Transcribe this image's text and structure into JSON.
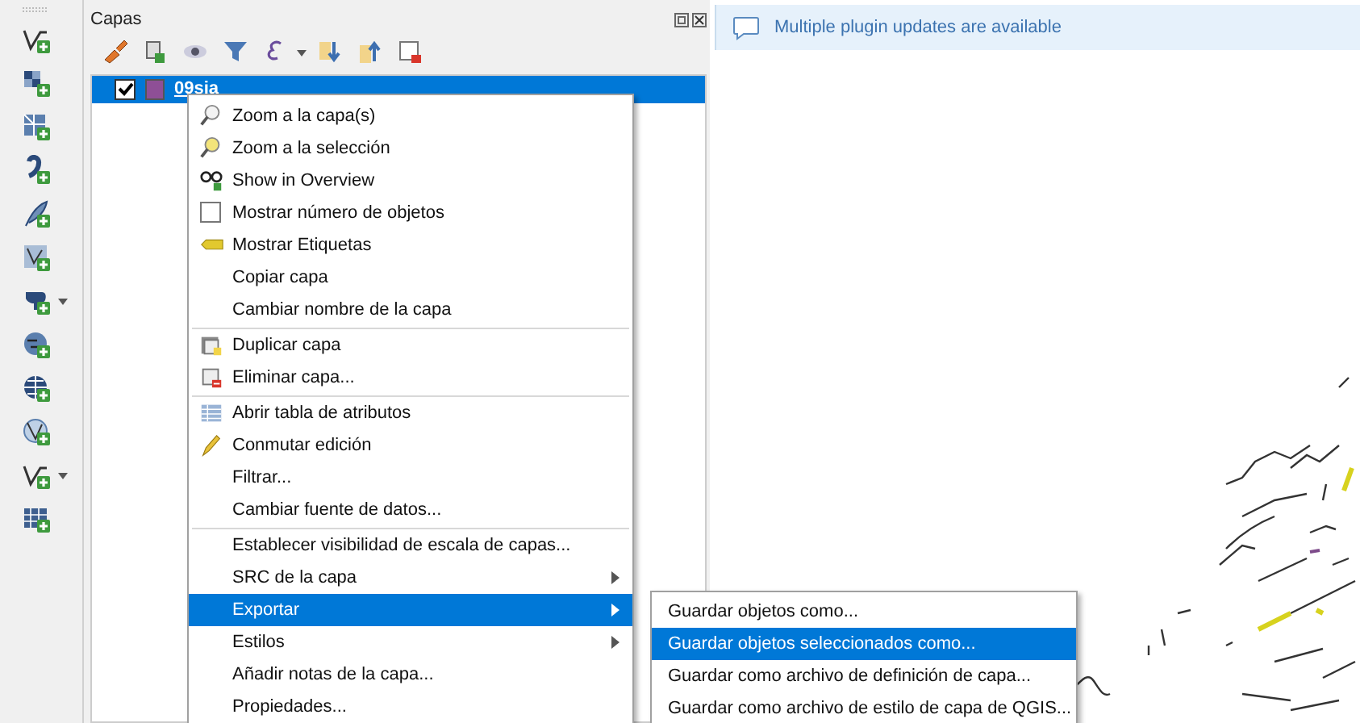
{
  "layers_panel": {
    "title": "Capas",
    "layers": [
      {
        "name": "09sia",
        "checked": true,
        "selected": true,
        "color": "#8e4f96"
      }
    ]
  },
  "message_bar": {
    "text": "Multiple plugin updates are available"
  },
  "context_menu": {
    "items": [
      {
        "kind": "action",
        "label": "Zoom a la capa(s)",
        "selected": false
      },
      {
        "kind": "action",
        "label": "Zoom a la selección",
        "selected": false
      },
      {
        "kind": "action",
        "label": "Show in Overview",
        "selected": false
      },
      {
        "kind": "checkbox",
        "label": "Mostrar número de objetos",
        "checked": false,
        "selected": false
      },
      {
        "kind": "action",
        "label": "Mostrar Etiquetas",
        "selected": false
      },
      {
        "kind": "action",
        "label": "Copiar capa",
        "selected": false
      },
      {
        "kind": "action",
        "label": "Cambiar nombre de la capa",
        "selected": false
      },
      {
        "kind": "separator"
      },
      {
        "kind": "action",
        "label": "Duplicar capa",
        "selected": false
      },
      {
        "kind": "action",
        "label": "Eliminar capa...",
        "selected": false
      },
      {
        "kind": "separator"
      },
      {
        "kind": "action",
        "label": "Abrir tabla de atributos",
        "selected": false
      },
      {
        "kind": "action",
        "label": "Conmutar edición",
        "selected": false
      },
      {
        "kind": "action",
        "label": "Filtrar...",
        "selected": false
      },
      {
        "kind": "action",
        "label": "Cambiar fuente de datos...",
        "selected": false
      },
      {
        "kind": "separator"
      },
      {
        "kind": "action",
        "label": "Establecer visibilidad de escala de capas...",
        "selected": false
      },
      {
        "kind": "submenu",
        "label": "SRC de la capa",
        "selected": false
      },
      {
        "kind": "submenu",
        "label": "Exportar",
        "selected": true
      },
      {
        "kind": "submenu",
        "label": "Estilos",
        "selected": false
      },
      {
        "kind": "action",
        "label": "Añadir notas de la capa...",
        "selected": false
      },
      {
        "kind": "action",
        "label": "Propiedades...",
        "selected": false
      }
    ]
  },
  "submenu": {
    "items": [
      {
        "label": "Guardar objetos como...",
        "selected": false
      },
      {
        "label": "Guardar objetos seleccionados como...",
        "selected": true
      },
      {
        "label": "Guardar como archivo de definición de capa...",
        "selected": false
      },
      {
        "label": "Guardar como archivo de estilo de capa de QGIS...",
        "selected": false
      }
    ]
  }
}
